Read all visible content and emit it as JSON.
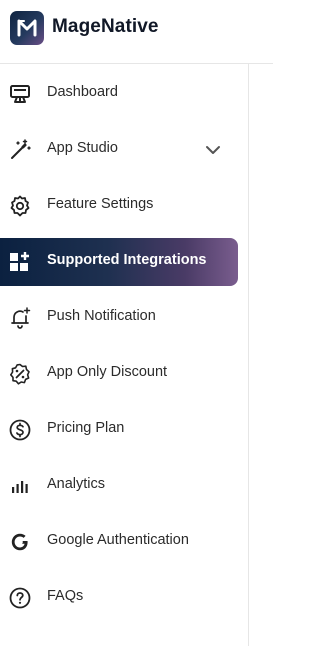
{
  "app": {
    "brand_name": "MageNative"
  },
  "sidebar": {
    "items": [
      {
        "label": "Dashboard",
        "icon": "dashboard-icon"
      },
      {
        "label": "App Studio",
        "icon": "magic-wand-icon",
        "has_dropdown": true
      },
      {
        "label": "Feature Settings",
        "icon": "gear-icon"
      },
      {
        "label": "Supported Integrations",
        "icon": "integrations-grid-icon",
        "active": true
      },
      {
        "label": "Push Notification",
        "icon": "bell-icon"
      },
      {
        "label": "App Only Discount",
        "icon": "discount-badge-icon"
      },
      {
        "label": "Pricing Plan",
        "icon": "dollar-circle-icon"
      },
      {
        "label": "Analytics",
        "icon": "bar-chart-icon"
      },
      {
        "label": "Google Authentication",
        "icon": "google-icon"
      },
      {
        "label": "FAQs",
        "icon": "question-circle-icon"
      }
    ]
  },
  "colors": {
    "active_gradient_start": "#0b2140",
    "active_gradient_end": "#7a5d8e",
    "text": "#2b2b2b",
    "icon": "#222222"
  }
}
